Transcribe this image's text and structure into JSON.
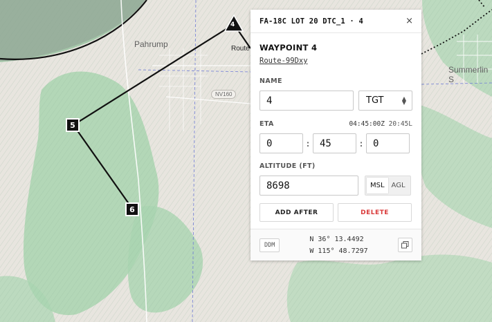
{
  "map": {
    "labels": {
      "pahrump": "Pahrump",
      "route": "Route",
      "summerlin": "Summerlin S",
      "road_shield": "NV160"
    },
    "markers": [
      "4",
      "5",
      "6"
    ]
  },
  "panel": {
    "header_title": "FA-18C LOT 20 DTC_1 · 4",
    "close_glyph": "×",
    "waypoint_title": "WAYPOINT 4",
    "route_link": "Route-99Dxy",
    "name": {
      "label": "NAME",
      "value": "4",
      "type_value": "TGT"
    },
    "eta": {
      "label": "ETA",
      "zulu": "04:45:00Z",
      "local": "20:45L",
      "hours": "0",
      "minutes": "45",
      "seconds": "0",
      "separator": ":"
    },
    "altitude": {
      "label": "ALTITUDE (FT)",
      "value": "8698",
      "options": [
        "MSL",
        "AGL"
      ],
      "selected": "MSL"
    },
    "buttons": {
      "add_after": "ADD AFTER",
      "delete": "DELETE"
    },
    "footer": {
      "format_button": "DDM",
      "lat": "N 36° 13.4492",
      "lon": "W 115° 48.7297"
    }
  },
  "colors": {
    "delete": "#d93a3a",
    "map_green": "#a9d5b0",
    "map_base": "#e8e5df",
    "route_line": "#111111"
  }
}
